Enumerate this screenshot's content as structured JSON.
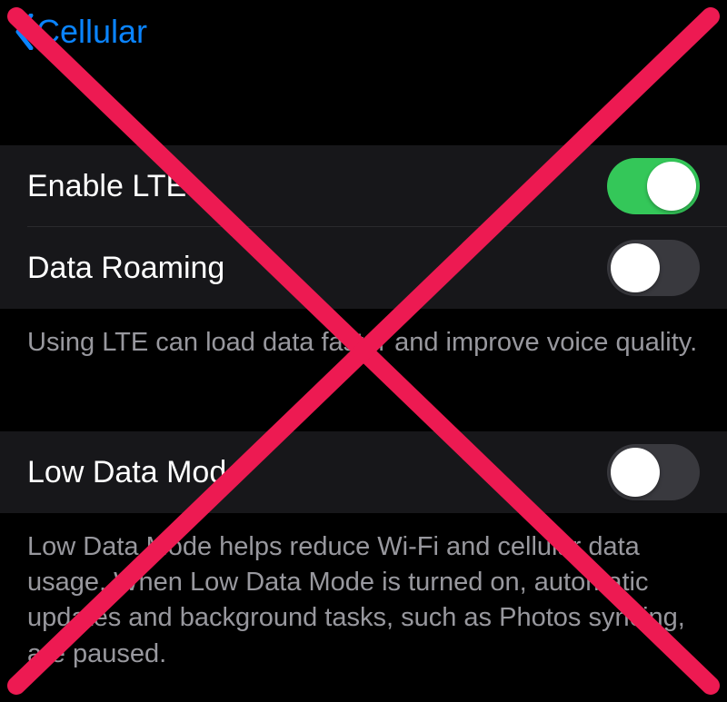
{
  "nav": {
    "back_label": "Cellular"
  },
  "group1": {
    "lte": {
      "label": "Enable LTE",
      "on": true
    },
    "roaming": {
      "label": "Data Roaming",
      "on": false
    },
    "footer": "Using LTE can load data faster and improve voice quality."
  },
  "group2": {
    "lowdata": {
      "label": "Low Data Mode",
      "on": false
    },
    "footer": "Low Data Mode helps reduce Wi-Fi and cellular data usage. When Low Data Mode is turned on, automatic updates and background tasks, such as Photos syncing, are paused."
  },
  "overlay": {
    "cross_color": "#ed1a52"
  }
}
